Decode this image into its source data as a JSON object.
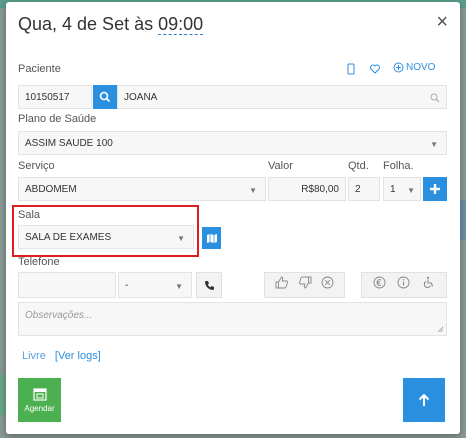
{
  "header": {
    "title_prefix": "Qua, 4 de Set às ",
    "title_time": "09:00",
    "close_label": "×"
  },
  "patient": {
    "label": "Paciente",
    "novo_label": "NOVO",
    "code": "10150517",
    "name": "JOANA"
  },
  "plan": {
    "label": "Plano de Saúde",
    "value": "ASSIM SAUDE 100"
  },
  "service": {
    "label": "Serviço",
    "valor_label": "Valor",
    "qtd_label": "Qtd.",
    "folha_label": "Folha.",
    "value": "ABDOMEM",
    "price": "R$80,00",
    "qtd": "2",
    "folha": "1"
  },
  "room": {
    "label": "Sala",
    "value": "SALA DE EXAMES"
  },
  "phone": {
    "label": "Telefone",
    "type_value": "-"
  },
  "notes": {
    "placeholder": "Observações..."
  },
  "footer": {
    "status": "Livre",
    "logs_link": "[Ver logs]",
    "agendar_label": "Agendar"
  },
  "colors": {
    "accent": "#2b8fe0",
    "success": "#4caf50",
    "highlight": "#e01d1d"
  }
}
